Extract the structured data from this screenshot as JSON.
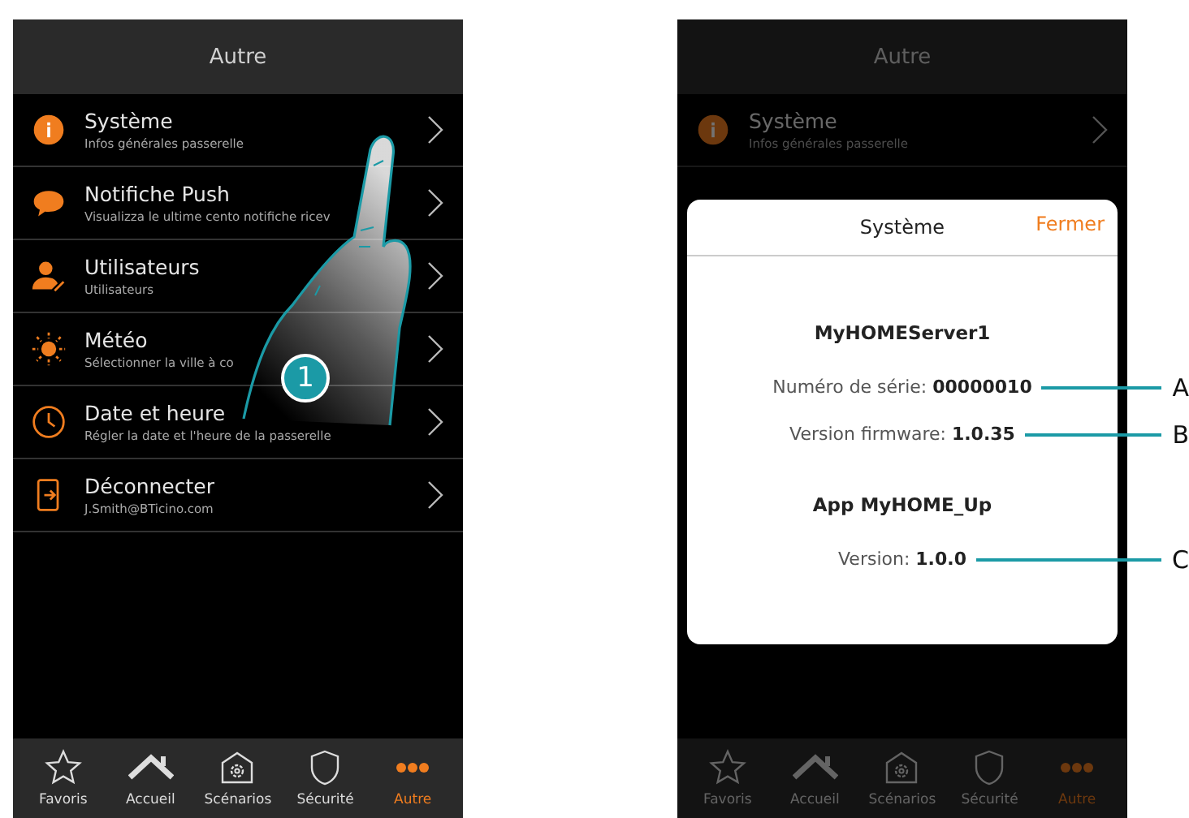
{
  "left_screen": {
    "dimmed": false,
    "header": {
      "title": "Autre"
    },
    "menu_items": [
      {
        "title": "Système",
        "subtitle": "Infos générales passerelle"
      },
      {
        "title": "Notifiche Push",
        "subtitle": "Visualizza le ultime cento notifiche ricev"
      },
      {
        "title": "Utilisateurs",
        "subtitle": "Utilisateurs"
      },
      {
        "title": "Météo",
        "subtitle": "Sélectionner la ville à co"
      },
      {
        "title": "Date et heure",
        "subtitle": "Régler la date et l'heure de la passerelle"
      },
      {
        "title": "Déconnecter",
        "subtitle": "J.Smith@BTicino.com"
      }
    ],
    "tab_bar": [
      {
        "label": "Favoris",
        "selected": false
      },
      {
        "label": "Accueil",
        "selected": false
      },
      {
        "label": "Scénarios",
        "selected": false
      },
      {
        "label": "Sécurité",
        "selected": false
      },
      {
        "label": "Autre",
        "selected": true
      }
    ]
  },
  "step_badge": "1",
  "right_screen": {
    "dimmed": true,
    "header": {
      "title": "Autre"
    },
    "menu_items": [
      {
        "title": "Système",
        "subtitle": "Infos générales passerelle"
      }
    ],
    "dialog": {
      "title": "Système",
      "close": "Fermer",
      "device_name": "MyHOMEServer1",
      "device_fields": [
        {
          "label": "Numéro de série:",
          "value": "00000010",
          "callout": "A"
        },
        {
          "label": "Version firmware:",
          "value": "1.0.35",
          "callout": "B"
        }
      ],
      "app_name": "App MyHOME_Up",
      "app_fields": [
        {
          "label": "Version:",
          "value": "1.0.0",
          "callout": "C"
        }
      ]
    },
    "tab_bar": [
      {
        "label": "Favoris",
        "selected": false
      },
      {
        "label": "Accueil",
        "selected": false
      },
      {
        "label": "Scénarios",
        "selected": false
      },
      {
        "label": "Sécurité",
        "selected": false
      },
      {
        "label": "Autre",
        "selected": true
      }
    ]
  }
}
